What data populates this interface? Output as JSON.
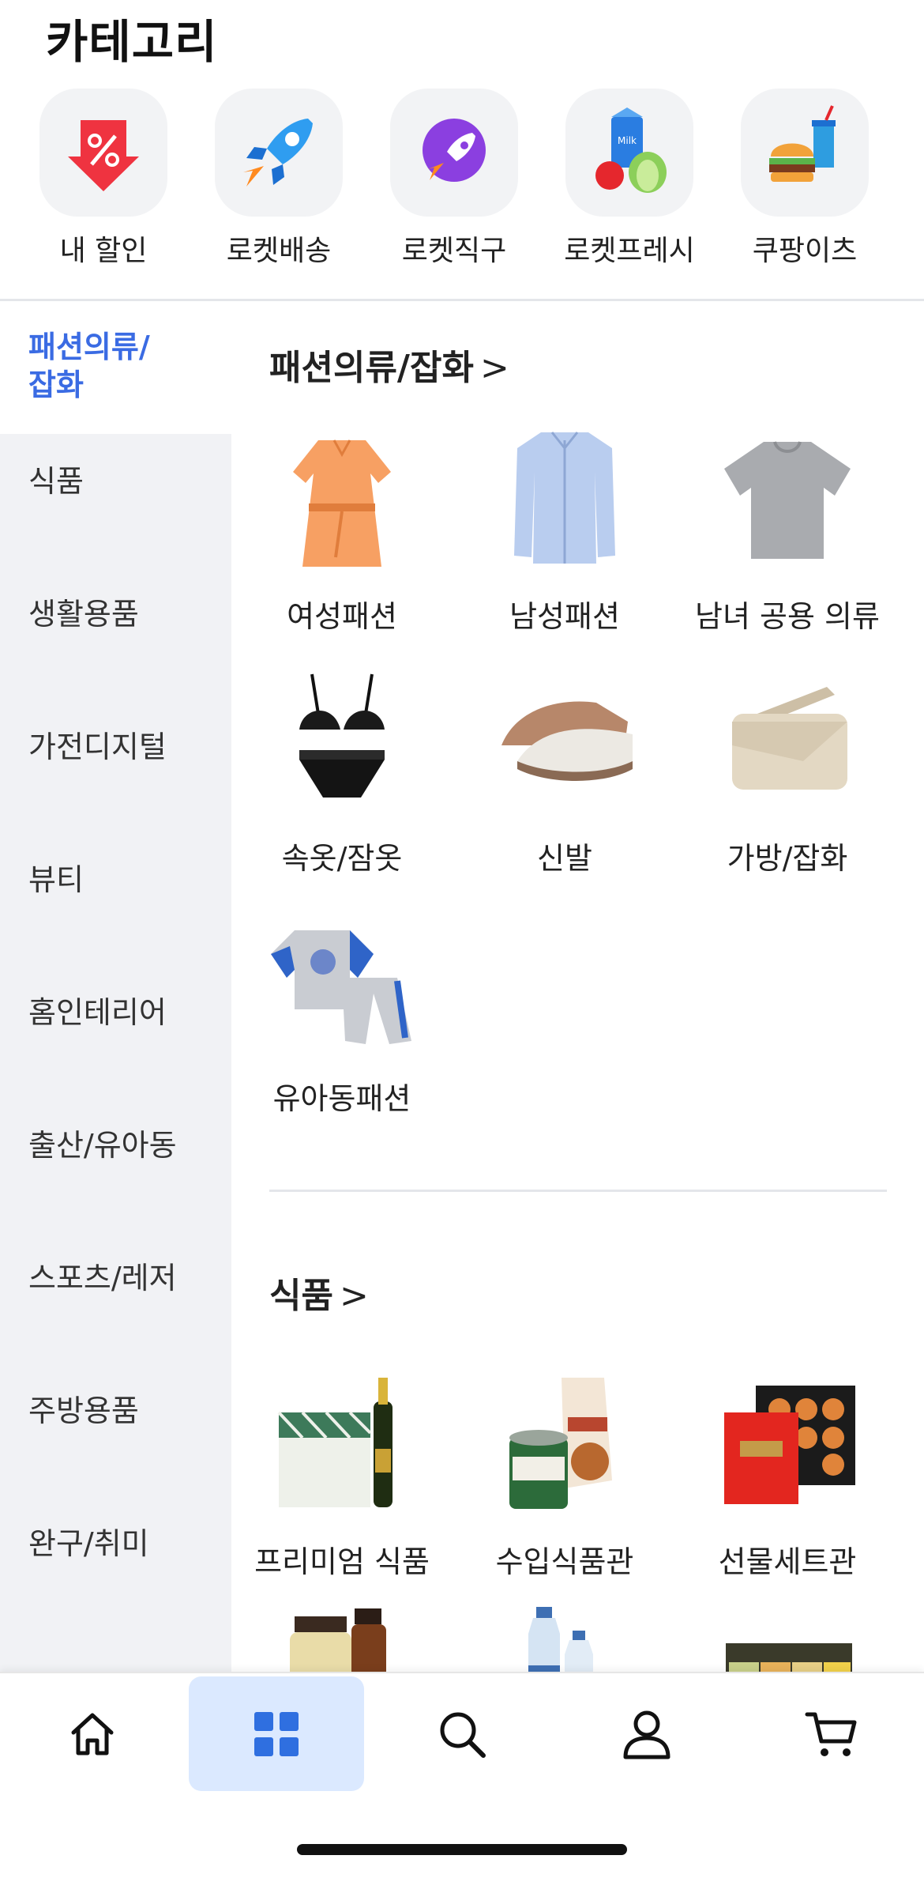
{
  "header": {
    "title": "카테고리"
  },
  "quick_links": [
    {
      "label": "내 할인",
      "icon": "discount-tag-icon"
    },
    {
      "label": "로켓배송",
      "icon": "rocket-icon"
    },
    {
      "label": "로켓직구",
      "icon": "purple-rocket-icon"
    },
    {
      "label": "로켓프레시",
      "icon": "grocery-icon"
    },
    {
      "label": "쿠팡이츠",
      "icon": "burger-drink-icon"
    }
  ],
  "sidebar": {
    "items": [
      {
        "label": "패션의류/\n잡화",
        "active": true
      },
      {
        "label": "식품"
      },
      {
        "label": "생활용품"
      },
      {
        "label": "가전디지털"
      },
      {
        "label": "뷰티"
      },
      {
        "label": "홈인테리어"
      },
      {
        "label": "출산/유아동"
      },
      {
        "label": "스포츠/레저"
      },
      {
        "label": "주방용품"
      },
      {
        "label": "완구/취미"
      }
    ]
  },
  "sections": [
    {
      "title": "패션의류/잡화",
      "chevron": ">",
      "items": [
        {
          "label": "여성패션",
          "image": "orange-dress-image"
        },
        {
          "label": "남성패션",
          "image": "blue-shirt-image"
        },
        {
          "label": "남녀 공용 의류",
          "image": "gray-tshirt-image"
        },
        {
          "label": "속옷/잠옷",
          "image": "black-lingerie-image"
        },
        {
          "label": "신발",
          "image": "sneaker-image"
        },
        {
          "label": "가방/잡화",
          "image": "beige-bag-image"
        },
        {
          "label": "유아동패션",
          "image": "kids-tracksuit-image"
        }
      ]
    },
    {
      "title": "식품",
      "chevron": ">",
      "items": [
        {
          "label": "프리미엄 식품",
          "image": "salt-oil-image"
        },
        {
          "label": "수입식품관",
          "image": "imported-food-image"
        },
        {
          "label": "선물세트관",
          "image": "gift-set-image"
        },
        {
          "label": "",
          "image": "supplement-bottles-image"
        },
        {
          "label": "",
          "image": "water-bottles-image"
        },
        {
          "label": "",
          "image": "tea-box-image"
        }
      ]
    }
  ],
  "bottom_nav": [
    {
      "name": "home",
      "icon": "home-icon"
    },
    {
      "name": "categories",
      "icon": "grid-icon",
      "active": true
    },
    {
      "name": "search",
      "icon": "search-icon"
    },
    {
      "name": "my-page",
      "icon": "person-icon"
    },
    {
      "name": "cart",
      "icon": "cart-icon"
    }
  ],
  "colors": {
    "accent": "#3a6be3",
    "sidebar_bg": "#f1f2f5",
    "active_nav_bg": "#dbe9ff"
  }
}
